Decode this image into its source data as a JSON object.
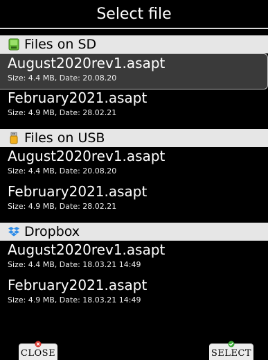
{
  "header": {
    "title": "Select file"
  },
  "sections": [
    {
      "title": "Files on SD",
      "icon": "sd-card-icon",
      "items": [
        {
          "name": "August2020rev1.asapt",
          "meta": "Size: 4.4 MB, Date: 20.08.20",
          "selected": true
        },
        {
          "name": "February2021.asapt",
          "meta": "Size: 4.9 MB, Date: 28.02.21"
        }
      ]
    },
    {
      "title": "Files on USB",
      "icon": "usb-drive-icon",
      "items": [
        {
          "name": "August2020rev1.asapt",
          "meta": "Size: 4.4 MB, Date: 20.08.20"
        },
        {
          "name": "February2021.asapt",
          "meta": "Size: 4.9 MB, Date: 28.02.21"
        }
      ]
    },
    {
      "title": "Dropbox",
      "icon": "dropbox-icon",
      "items": [
        {
          "name": "August2020rev1.asapt",
          "meta": "Size: 4.4 MB, Date: 18.03.21 14:49"
        },
        {
          "name": "February2021.asapt",
          "meta": "Size: 4.9 MB, Date: 18.03.21 14:49"
        }
      ]
    }
  ],
  "footer": {
    "close_label": "CLOSE",
    "select_label": "SELECT"
  },
  "colors": {
    "background": "#000000",
    "section_header": "#e6e6e6",
    "selected_row": "#3a3a3a",
    "close_badge": "#d9342b",
    "select_badge": "#3aa935"
  }
}
